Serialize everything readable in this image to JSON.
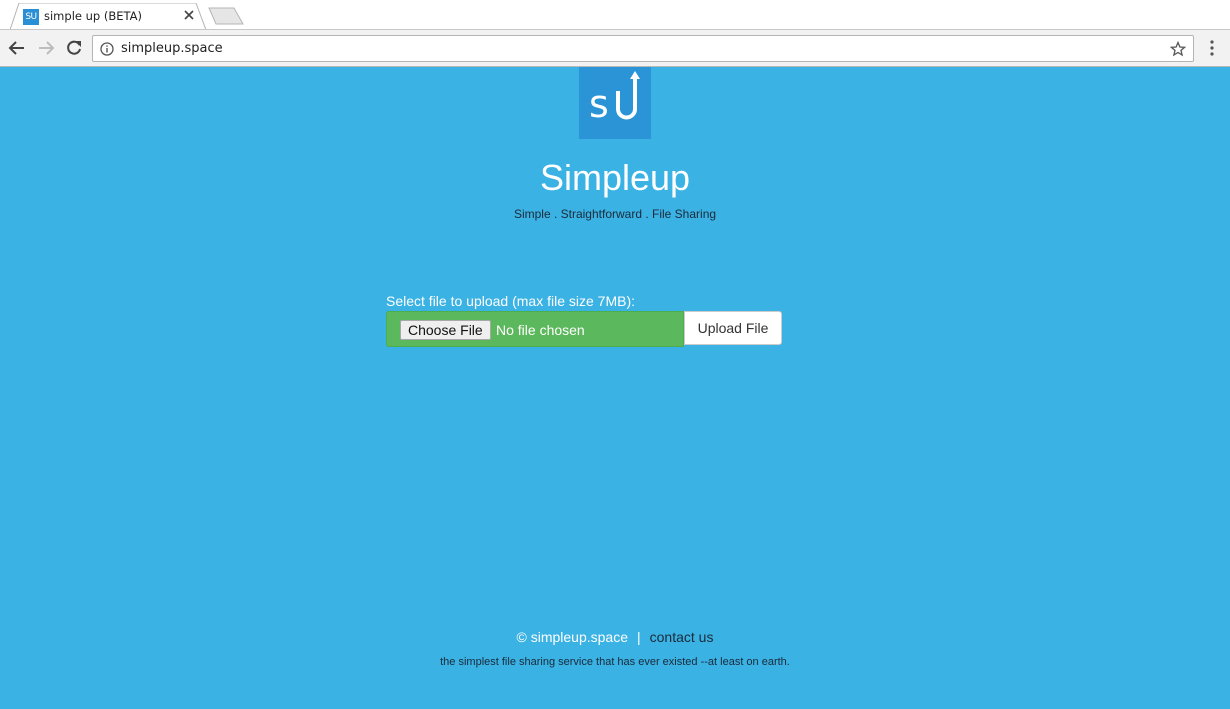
{
  "browser": {
    "tab_title": "simple up (BETA)",
    "favicon_text": "SU",
    "url": "simpleup.space"
  },
  "page": {
    "logo_text": "SU",
    "title": "Simpleup",
    "tagline": "Simple . Straightforward . File Sharing",
    "upload_label": "Select file to upload (max file size 7MB):",
    "choose_file_label": "Choose File",
    "no_file_text": "No file chosen",
    "upload_button_label": "Upload File",
    "footer_copyright": "© simpleup.space",
    "footer_separator": "|",
    "footer_contact": "contact us",
    "footer_note": "the simplest file sharing service that has ever existed --at least on earth."
  },
  "colors": {
    "page_background": "#3ab2e4",
    "logo_background": "#2a94d6",
    "file_box_green": "#5cb85c"
  }
}
